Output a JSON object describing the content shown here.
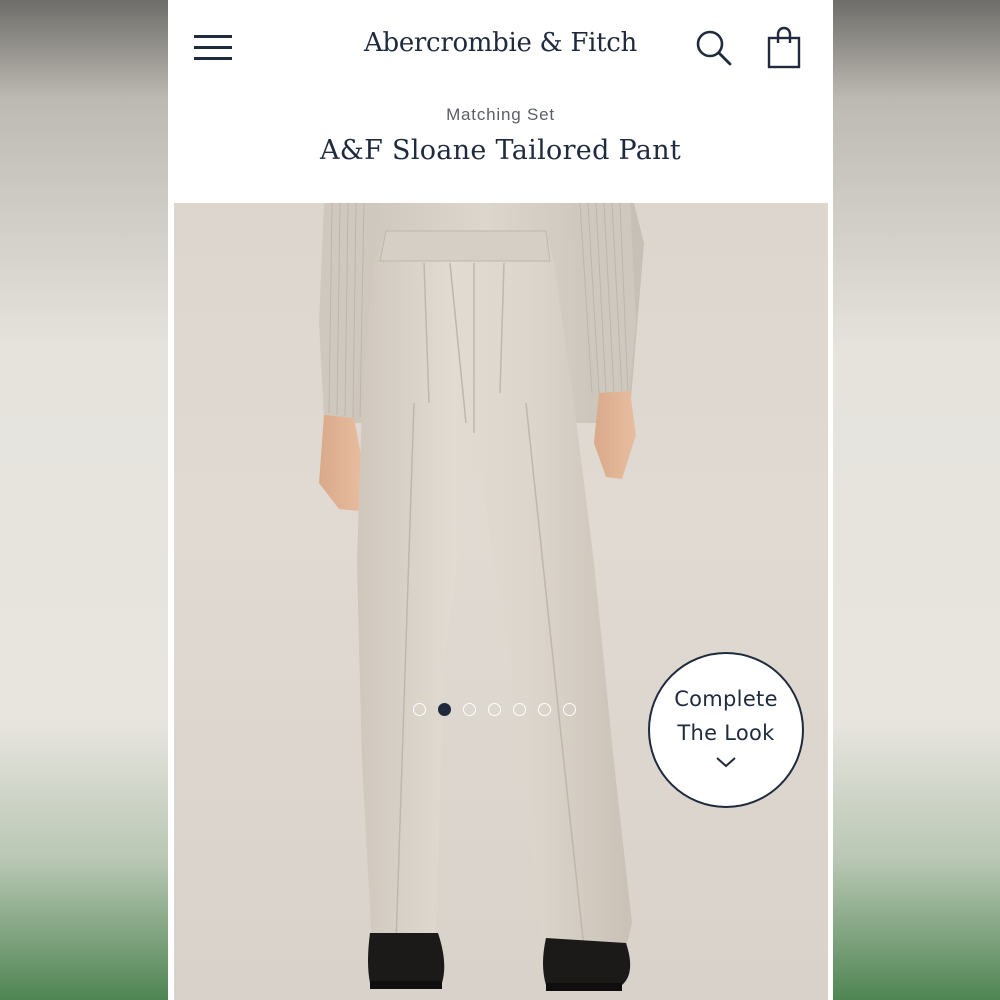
{
  "header": {
    "brand": "Abercrombie & Fitch",
    "menu_icon": "hamburger-menu-icon",
    "search_icon": "search-icon",
    "bag_icon": "shopping-bag-icon"
  },
  "product": {
    "collection_label": "Matching Set",
    "name": "A&F Sloane Tailored Pant",
    "image_alt": "Model wearing light taupe wide-leg tailored pants with a ribbed knit top and black loafers"
  },
  "gallery": {
    "total_images": 7,
    "active_index": 1
  },
  "complete_look": {
    "line1": "Complete",
    "line2": "The Look",
    "icon": "chevron-down-icon"
  },
  "colors": {
    "brand_navy": "#1f2b3d",
    "product_taupe": "#d9d2c8",
    "background": "#ffffff"
  }
}
